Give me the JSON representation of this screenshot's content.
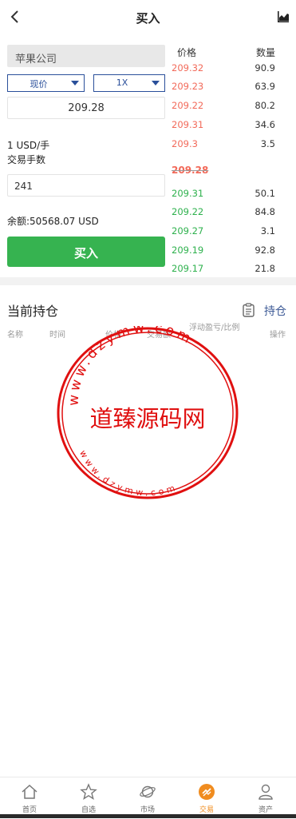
{
  "header": {
    "title": "买入"
  },
  "form": {
    "stock_name": "苹果公司",
    "order_type": "现价",
    "leverage": "1X",
    "price": "209.28",
    "unit_text": "1 USD/手",
    "lots_label": "交易手数",
    "lots_value": "241",
    "balance_text": "余额:50568.07 USD",
    "buy_label": "买入"
  },
  "orderbook": {
    "price_header": "价格",
    "qty_header": "数量",
    "asks": [
      {
        "price": "209.32",
        "qty": "90.9"
      },
      {
        "price": "209.23",
        "qty": "63.9"
      },
      {
        "price": "209.22",
        "qty": "80.2"
      },
      {
        "price": "209.31",
        "qty": "34.6"
      },
      {
        "price": "209.3",
        "qty": "3.5"
      }
    ],
    "current": "209.28",
    "bids": [
      {
        "price": "209.31",
        "qty": "50.1"
      },
      {
        "price": "209.22",
        "qty": "84.8"
      },
      {
        "price": "209.27",
        "qty": "3.1"
      },
      {
        "price": "209.19",
        "qty": "92.8"
      },
      {
        "price": "209.17",
        "qty": "21.8"
      }
    ]
  },
  "positions": {
    "title": "当前持仓",
    "link": "持仓",
    "columns": [
      "名称",
      "时间",
      "价格",
      "交易额",
      "浮动盈亏/比例",
      "操作"
    ]
  },
  "watermark": {
    "text": "道臻源码网",
    "url_top": "www.dzymw.com",
    "url_bottom": "www.dzymw.com"
  },
  "tabbar": {
    "items": [
      {
        "label": "首页",
        "icon": "home-icon"
      },
      {
        "label": "自选",
        "icon": "star-icon"
      },
      {
        "label": "市场",
        "icon": "planet-icon"
      },
      {
        "label": "交易",
        "icon": "trade-icon"
      },
      {
        "label": "资产",
        "icon": "user-icon"
      }
    ],
    "active": "交易"
  },
  "colors": {
    "buy_green": "#36b350",
    "ask_red": "#f26a5a",
    "bid_green": "#2eb14d",
    "active_tab": "#f08c1f",
    "stamp_red": "#e01010"
  }
}
